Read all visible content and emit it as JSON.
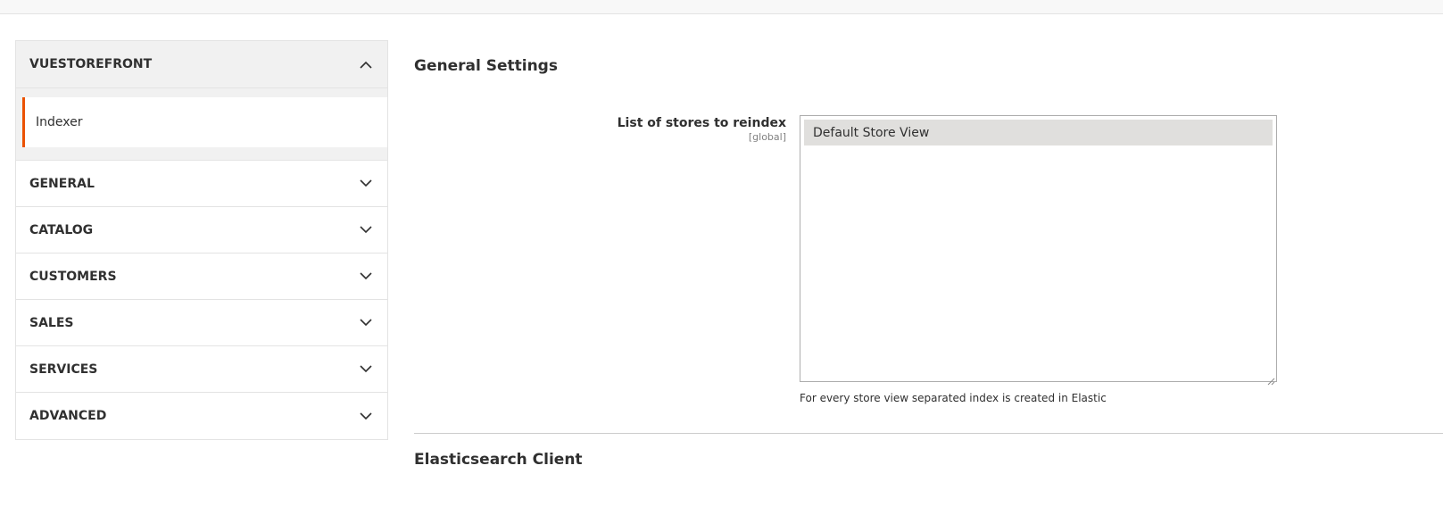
{
  "sidebar": {
    "open_section": {
      "label": "VUESTOREFRONT",
      "icon": "chevron-up-icon"
    },
    "active_item": {
      "label": "Indexer",
      "accent": "#eb5202"
    },
    "sections": [
      {
        "label": "GENERAL",
        "icon": "chevron-down-icon"
      },
      {
        "label": "CATALOG",
        "icon": "chevron-down-icon"
      },
      {
        "label": "CUSTOMERS",
        "icon": "chevron-down-icon"
      },
      {
        "label": "SALES",
        "icon": "chevron-down-icon"
      },
      {
        "label": "SERVICES",
        "icon": "chevron-down-icon"
      },
      {
        "label": "ADVANCED",
        "icon": "chevron-down-icon"
      }
    ]
  },
  "main": {
    "group_title": "General Settings",
    "field": {
      "label": "List of stores to reindex",
      "scope": "[global]",
      "options": [
        "Default Store View"
      ],
      "selected": "Default Store View",
      "note": "For every store view separated index is created in Elastic"
    },
    "next_group_title": "Elasticsearch Client"
  },
  "colors": {
    "accent": "#eb5202",
    "selected_option_bg": "#e0dfdd",
    "open_section_bg": "#f1f1f1"
  }
}
